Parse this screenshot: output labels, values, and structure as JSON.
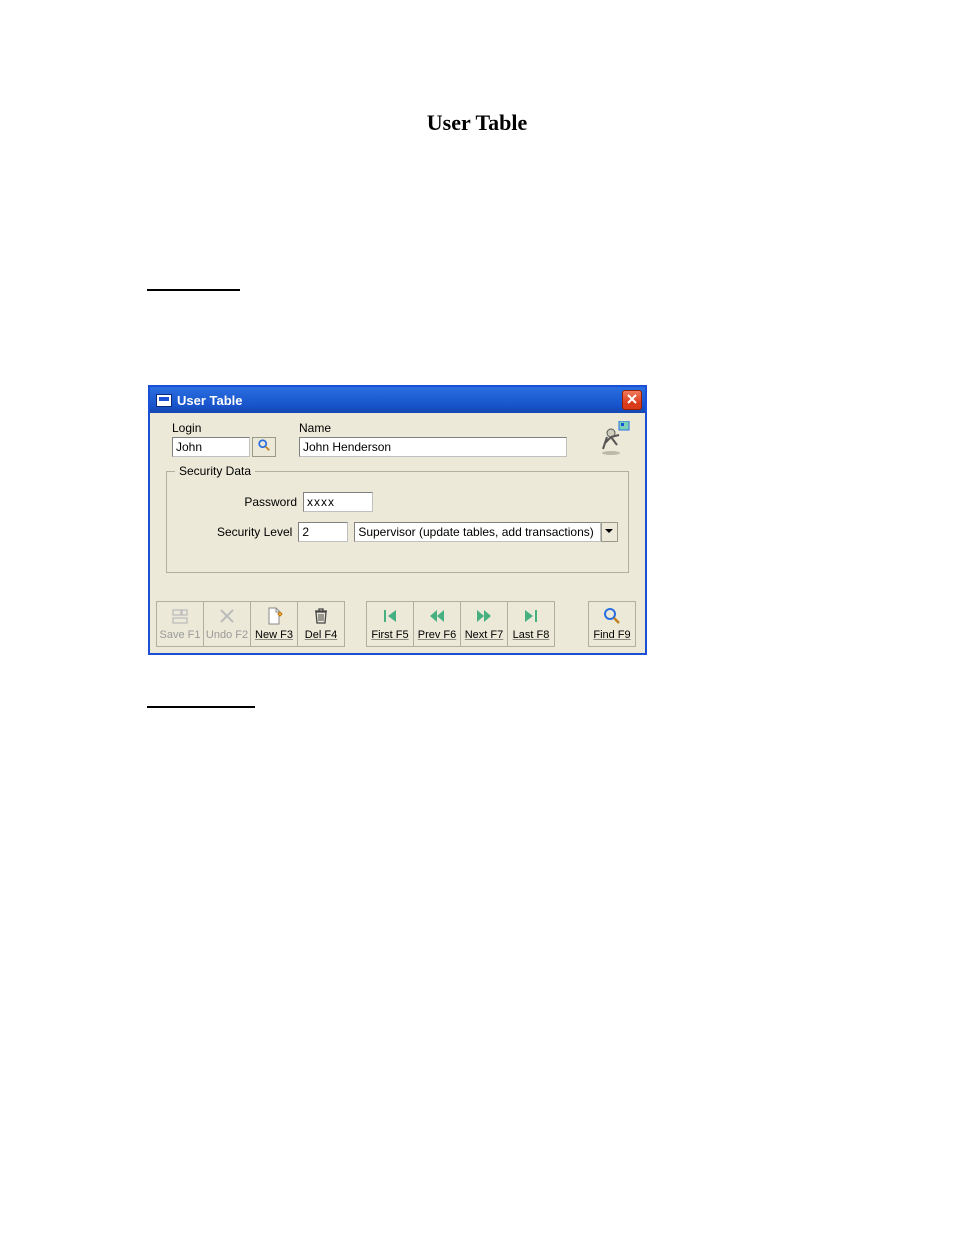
{
  "page": {
    "title": "User Table"
  },
  "window": {
    "title": "User Table",
    "form": {
      "login_label": "Login",
      "login_value": "John",
      "name_label": "Name",
      "name_value": "John Henderson"
    },
    "security": {
      "legend": "Security Data",
      "password_label": "Password",
      "password_value": "xxxx",
      "level_label": "Security Level",
      "level_value": "2",
      "level_desc": "Supervisor (update tables, add transactions)"
    },
    "toolbar": {
      "save": "Save F1",
      "undo": "Undo F2",
      "new": "New F3",
      "del": "Del F4",
      "first": "First F5",
      "prev": "Prev F6",
      "next": "Next F7",
      "last": "Last F8",
      "find": "Find F9"
    }
  }
}
